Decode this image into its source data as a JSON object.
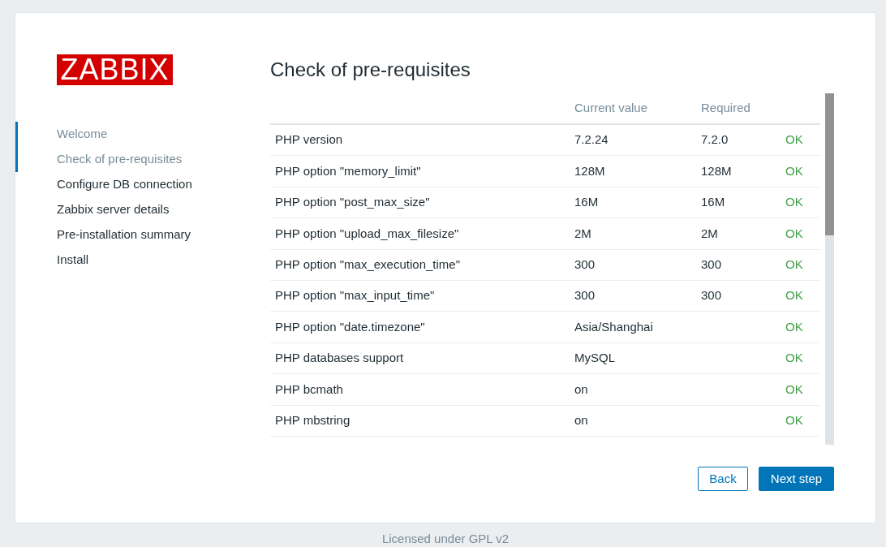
{
  "logo": {
    "text": "ZABBIX"
  },
  "steps": [
    {
      "label": "Welcome",
      "visited": true
    },
    {
      "label": "Check of pre-requisites",
      "visited": true
    },
    {
      "label": "Configure DB connection",
      "visited": false
    },
    {
      "label": "Zabbix server details",
      "visited": false
    },
    {
      "label": "Pre-installation summary",
      "visited": false
    },
    {
      "label": "Install",
      "visited": false
    }
  ],
  "page_title": "Check of pre-requisites",
  "table": {
    "columns": {
      "current": "Current value",
      "required": "Required"
    },
    "rows": [
      {
        "name": "PHP version",
        "current": "7.2.24",
        "required": "7.2.0",
        "status": "OK",
        "passed": true
      },
      {
        "name": "PHP option \"memory_limit\"",
        "current": "128M",
        "required": "128M",
        "status": "OK",
        "passed": true
      },
      {
        "name": "PHP option \"post_max_size\"",
        "current": "16M",
        "required": "16M",
        "status": "OK",
        "passed": true
      },
      {
        "name": "PHP option \"upload_max_filesize\"",
        "current": "2M",
        "required": "2M",
        "status": "OK",
        "passed": true
      },
      {
        "name": "PHP option \"max_execution_time\"",
        "current": "300",
        "required": "300",
        "status": "OK",
        "passed": true
      },
      {
        "name": "PHP option \"max_input_time\"",
        "current": "300",
        "required": "300",
        "status": "OK",
        "passed": true
      },
      {
        "name": "PHP option \"date.timezone\"",
        "current": "Asia/Shanghai",
        "status": "OK",
        "passed": true
      },
      {
        "name": "PHP databases support",
        "current": "MySQL",
        "status": "OK",
        "passed": true
      },
      {
        "name": "PHP bcmath",
        "current": "on",
        "status": "OK",
        "passed": true
      },
      {
        "name": "PHP mbstring",
        "current": "on",
        "status": "OK",
        "passed": true
      }
    ]
  },
  "buttons": {
    "back": "Back",
    "next": "Next step"
  },
  "footer": "Licensed under GPL v2"
}
